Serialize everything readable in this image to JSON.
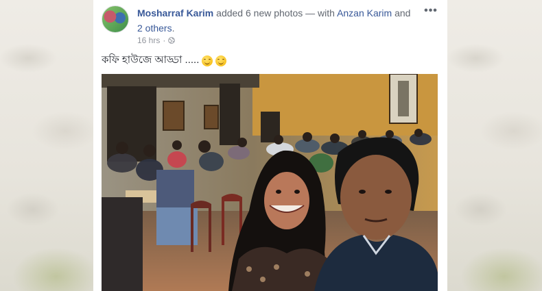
{
  "post": {
    "author": "Mosharraf Karim",
    "action_text": " added 6 new photos — with ",
    "tagged_person": "Anzan Karim",
    "and_text": " and ",
    "others_text": "2 others",
    "period": ".",
    "timestamp": "16 hrs",
    "separator": "·",
    "caption": "কফি হাউজে আড্ডা .....",
    "more_label": "•••"
  },
  "icons": {
    "privacy": "globe-icon",
    "emoji": "smiling-face-icon",
    "more": "more-options-icon"
  },
  "colors": {
    "link": "#385898",
    "meta": "#90949c",
    "text": "#1d2129"
  }
}
